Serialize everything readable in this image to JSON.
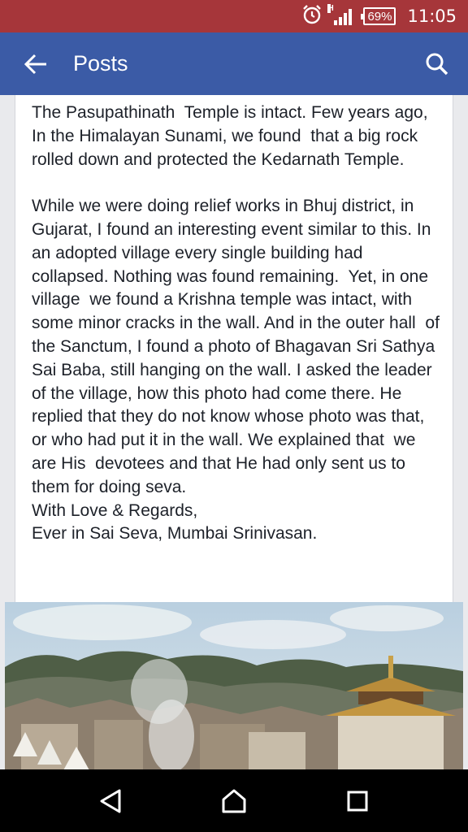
{
  "status_bar": {
    "network_type": "H",
    "battery": "69%",
    "time": "11:05",
    "icons": [
      "alarm-icon",
      "signal-icon",
      "battery-icon"
    ],
    "background": "#a6363a"
  },
  "app_bar": {
    "title": "Posts",
    "background": "#3b5ba6",
    "icons": [
      "back-arrow-icon",
      "search-icon"
    ]
  },
  "post": {
    "paragraph_1": "The Pasupathinath  Temple is intact. Few years ago,  In the Himalayan Sunami, we found  that a big rock rolled down and protected the Kedarnath Temple.",
    "paragraph_2": "While we were doing relief works in Bhuj district, in Gujarat, I found an interesting event similar to this. In an adopted village every single building had collapsed. Nothing was found remaining.  Yet, in one  village  we found a Krishna temple was intact, with some minor cracks in the wall. And in the outer hall  of the Sanctum, I found a photo of Bhagavan Sri Sathya Sai Baba, still hanging on the wall. I asked the leader of the village, how this photo had come there. He replied that they do not know whose photo was that, or who had put it in the wall. We explained that  we are His  devotees and that He had only sent us to them for doing seva.",
    "closing": "With Love & Regards,",
    "signature": "Ever in Sai Seva, Mumbai Srinivasan."
  },
  "photo": {
    "icon": "temple-photo"
  },
  "nav_bar": {
    "icons": [
      "back-triangle-icon",
      "home-icon",
      "recents-icon"
    ]
  }
}
